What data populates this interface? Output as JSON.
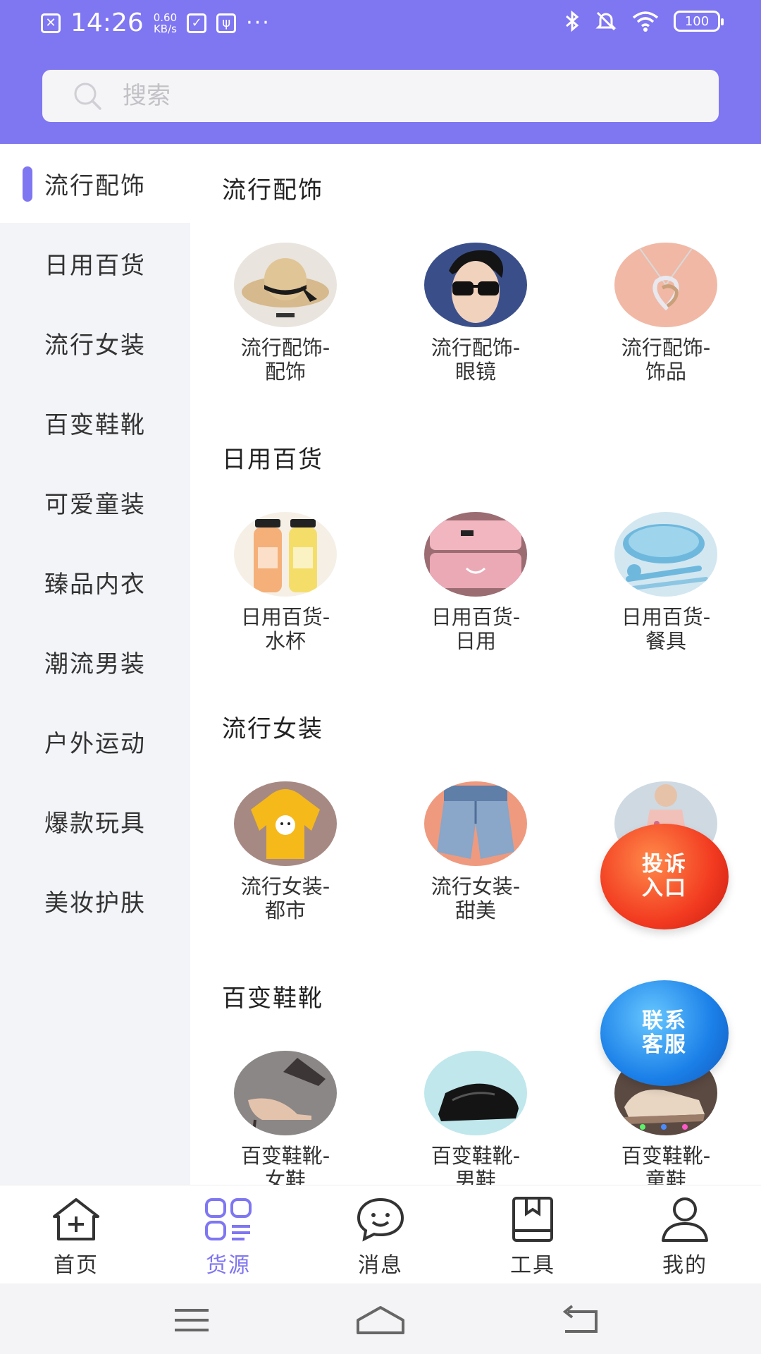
{
  "status_bar": {
    "time": "14:26",
    "speed_value": "0.60",
    "speed_unit": "KB/s",
    "dots": "···",
    "battery": "100"
  },
  "search": {
    "placeholder": "搜索",
    "value": ""
  },
  "sidebar": {
    "items": [
      {
        "label": "流行配饰",
        "active": true
      },
      {
        "label": "日用百货"
      },
      {
        "label": "流行女装"
      },
      {
        "label": "百变鞋靴"
      },
      {
        "label": "可爱童装"
      },
      {
        "label": "臻品内衣"
      },
      {
        "label": "潮流男装"
      },
      {
        "label": "户外运动"
      },
      {
        "label": "爆款玩具"
      },
      {
        "label": "美妆护肤"
      }
    ]
  },
  "sections": [
    {
      "title": "流行配饰",
      "items": [
        {
          "label": "流行配饰-配饰",
          "icon": "straw-hat-icon"
        },
        {
          "label": "流行配饰-眼镜",
          "icon": "sunglasses-icon"
        },
        {
          "label": "流行配饰-饰品",
          "icon": "necklace-icon"
        }
      ]
    },
    {
      "title": "日用百货",
      "items": [
        {
          "label": "日用百货-水杯",
          "icon": "water-bottle-icon"
        },
        {
          "label": "日用百货-日用",
          "icon": "storage-box-icon"
        },
        {
          "label": "日用百货-餐具",
          "icon": "tableware-icon"
        }
      ]
    },
    {
      "title": "流行女装",
      "items": [
        {
          "label": "流行女装-都市",
          "icon": "hoodie-icon"
        },
        {
          "label": "流行女装-甜美",
          "icon": "denim-shorts-icon"
        },
        {
          "label": "",
          "icon": "dress-icon"
        }
      ]
    },
    {
      "title": "百变鞋靴",
      "items": [
        {
          "label": "百变鞋靴-女鞋",
          "icon": "heels-icon"
        },
        {
          "label": "百变鞋靴-男鞋",
          "icon": "leather-shoe-icon"
        },
        {
          "label": "百变鞋靴-童鞋",
          "icon": "kids-sneaker-icon"
        }
      ]
    }
  ],
  "floating": {
    "complaint": "投诉入口",
    "service": "联系客服"
  },
  "bottom_nav": {
    "items": [
      {
        "label": "首页",
        "icon": "home-plus-icon"
      },
      {
        "label": "货源",
        "icon": "grid-list-icon",
        "active": true
      },
      {
        "label": "消息",
        "icon": "chat-smile-icon"
      },
      {
        "label": "工具",
        "icon": "bookmark-book-icon"
      },
      {
        "label": "我的",
        "icon": "user-icon"
      }
    ]
  },
  "colors": {
    "accent": "#7f76f2",
    "sidebar_bg": "#f3f4f8",
    "complaint": "#f23a20",
    "service": "#1a7fe8"
  }
}
